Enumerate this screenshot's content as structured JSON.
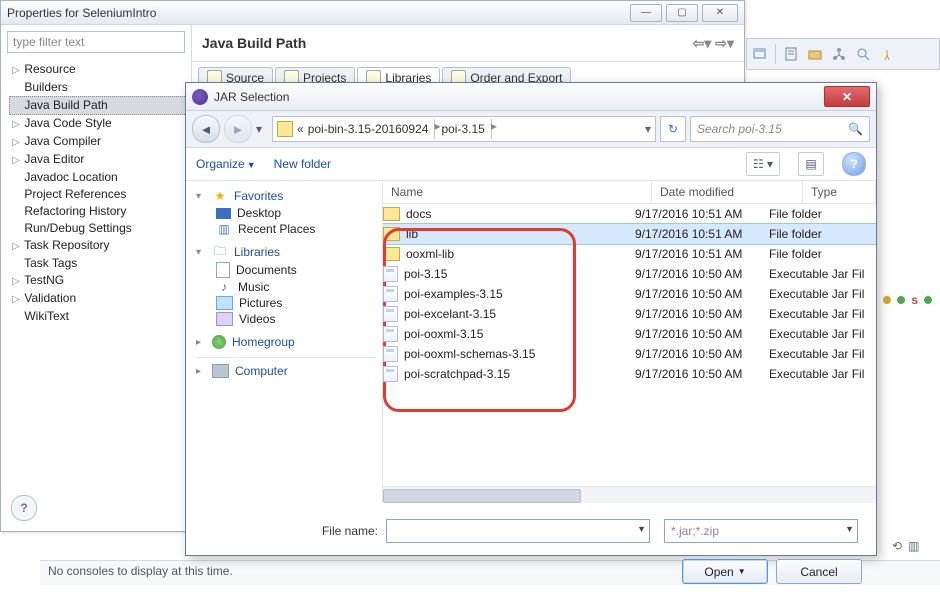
{
  "propWin": {
    "title": "Properties for SeleniumIntro",
    "filterPlaceholder": "type filter text",
    "header": "Java Build Path",
    "tree": [
      {
        "label": "Resource",
        "chev": "▷"
      },
      {
        "label": "Builders"
      },
      {
        "label": "Java Build Path",
        "sel": true
      },
      {
        "label": "Java Code Style",
        "chev": "▷"
      },
      {
        "label": "Java Compiler",
        "chev": "▷"
      },
      {
        "label": "Java Editor",
        "chev": "▷"
      },
      {
        "label": "Javadoc Location"
      },
      {
        "label": "Project References"
      },
      {
        "label": "Refactoring History"
      },
      {
        "label": "Run/Debug Settings"
      },
      {
        "label": "Task Repository",
        "chev": "▷"
      },
      {
        "label": "Task Tags"
      },
      {
        "label": "TestNG",
        "chev": "▷"
      },
      {
        "label": "Validation",
        "chev": "▷"
      },
      {
        "label": "WikiText"
      }
    ],
    "tabs": [
      {
        "label": "Source"
      },
      {
        "label": "Projects"
      },
      {
        "label": "Libraries",
        "active": true
      },
      {
        "label": "Order and Export"
      }
    ]
  },
  "dlg": {
    "title": "JAR Selection",
    "breadcrumb": {
      "pre": "«",
      "a": "poi-bin-3.15-20160924",
      "b": "poi-3.15"
    },
    "searchPlaceholder": "Search poi-3.15",
    "organize": "Organize",
    "newFolder": "New folder",
    "places": {
      "favorites": "Favorites",
      "desktop": "Desktop",
      "recent": "Recent Places",
      "libraries": "Libraries",
      "documents": "Documents",
      "music": "Music",
      "pictures": "Pictures",
      "videos": "Videos",
      "homegroup": "Homegroup",
      "computer": "Computer"
    },
    "columns": {
      "name": "Name",
      "dm": "Date modified",
      "type": "Type"
    },
    "rows": [
      {
        "name": "docs",
        "kind": "folder",
        "dm": "9/17/2016 10:51 AM",
        "type": "File folder"
      },
      {
        "name": "lib",
        "kind": "folder",
        "dm": "9/17/2016 10:51 AM",
        "type": "File folder",
        "sel": true
      },
      {
        "name": "ooxml-lib",
        "kind": "folder",
        "dm": "9/17/2016 10:51 AM",
        "type": "File folder"
      },
      {
        "name": "poi-3.15",
        "kind": "jar",
        "dm": "9/17/2016 10:50 AM",
        "type": "Executable Jar Fil"
      },
      {
        "name": "poi-examples-3.15",
        "kind": "jar",
        "dm": "9/17/2016 10:50 AM",
        "type": "Executable Jar Fil"
      },
      {
        "name": "poi-excelant-3.15",
        "kind": "jar",
        "dm": "9/17/2016 10:50 AM",
        "type": "Executable Jar Fil"
      },
      {
        "name": "poi-ooxml-3.15",
        "kind": "jar",
        "dm": "9/17/2016 10:50 AM",
        "type": "Executable Jar Fil"
      },
      {
        "name": "poi-ooxml-schemas-3.15",
        "kind": "jar",
        "dm": "9/17/2016 10:50 AM",
        "type": "Executable Jar Fil"
      },
      {
        "name": "poi-scratchpad-3.15",
        "kind": "jar",
        "dm": "9/17/2016 10:50 AM",
        "type": "Executable Jar Fil"
      }
    ],
    "fileNameLabel": "File name:",
    "fileNameValue": "",
    "filterValue": "*.jar;*.zip",
    "open": "Open",
    "cancel": "Cancel"
  },
  "console": "No consoles to display at this time."
}
